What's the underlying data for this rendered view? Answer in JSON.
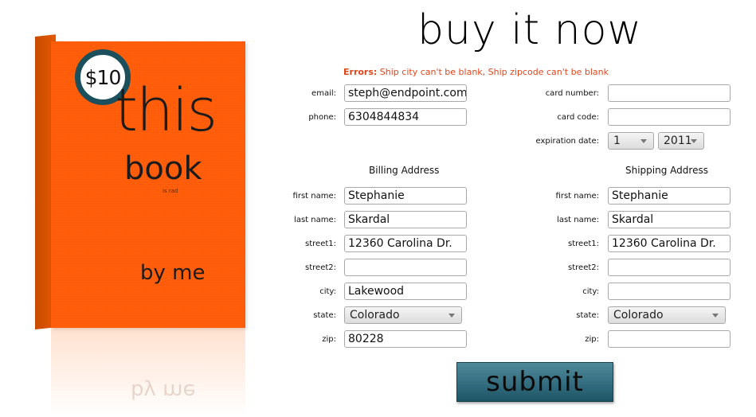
{
  "product": {
    "price": "$10",
    "title_line1": "this",
    "title_line2": "book",
    "tagline": "is rad",
    "author": "by me",
    "reflection_text": "by me"
  },
  "page": {
    "title": "buy it now",
    "error_label": "Errors:",
    "error_text": "Ship city can't be blank, Ship zipcode can't be blank"
  },
  "contact": {
    "email_label": "email:",
    "email_value": "steph@endpoint.com",
    "phone_label": "phone:",
    "phone_value": "6304844834"
  },
  "payment": {
    "card_number_label": "card number:",
    "card_number_value": "",
    "card_code_label": "card code:",
    "card_code_value": "",
    "expiration_label": "expiration date:",
    "exp_month": "1",
    "exp_year": "2011"
  },
  "billing": {
    "heading": "Billing Address",
    "first_name_label": "first name:",
    "first_name": "Stephanie",
    "last_name_label": "last name:",
    "last_name": "Skardal",
    "street1_label": "street1:",
    "street1": "12360 Carolina Dr.",
    "street2_label": "street2:",
    "street2": "",
    "city_label": "city:",
    "city": "Lakewood",
    "state_label": "state:",
    "state": "Colorado",
    "zip_label": "zip:",
    "zip": "80228"
  },
  "shipping": {
    "heading": "Shipping Address",
    "first_name_label": "first name:",
    "first_name": "Stephanie",
    "last_name_label": "last name:",
    "last_name": "Skardal",
    "street1_label": "street1:",
    "street1": "12360 Carolina Dr.",
    "street2_label": "street2:",
    "street2": "",
    "city_label": "city:",
    "city": "",
    "state_label": "state:",
    "state": "Colorado",
    "zip_label": "zip:",
    "zip": ""
  },
  "actions": {
    "submit_label": "submit"
  },
  "colors": {
    "book_orange": "#ff5b06",
    "badge_ring": "#1c4f5c",
    "error_red": "#e0461c",
    "submit_teal": "#1d5567"
  }
}
